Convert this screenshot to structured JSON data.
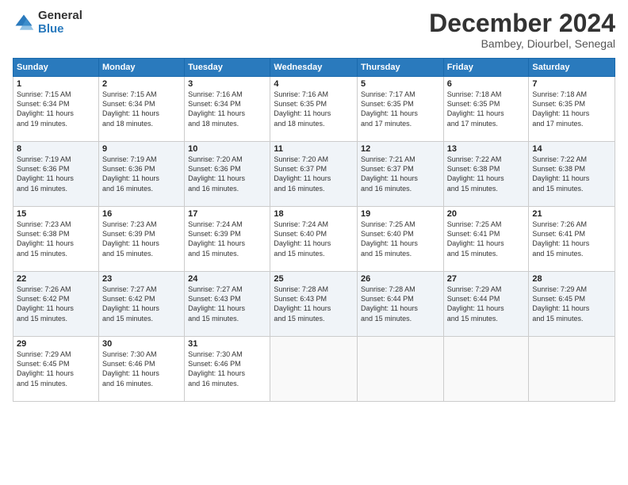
{
  "logo": {
    "general": "General",
    "blue": "Blue"
  },
  "title": "December 2024",
  "location": "Bambey, Diourbel, Senegal",
  "headers": [
    "Sunday",
    "Monday",
    "Tuesday",
    "Wednesday",
    "Thursday",
    "Friday",
    "Saturday"
  ],
  "weeks": [
    [
      {
        "day": "1",
        "info": "Sunrise: 7:15 AM\nSunset: 6:34 PM\nDaylight: 11 hours\nand 19 minutes."
      },
      {
        "day": "2",
        "info": "Sunrise: 7:15 AM\nSunset: 6:34 PM\nDaylight: 11 hours\nand 18 minutes."
      },
      {
        "day": "3",
        "info": "Sunrise: 7:16 AM\nSunset: 6:34 PM\nDaylight: 11 hours\nand 18 minutes."
      },
      {
        "day": "4",
        "info": "Sunrise: 7:16 AM\nSunset: 6:35 PM\nDaylight: 11 hours\nand 18 minutes."
      },
      {
        "day": "5",
        "info": "Sunrise: 7:17 AM\nSunset: 6:35 PM\nDaylight: 11 hours\nand 17 minutes."
      },
      {
        "day": "6",
        "info": "Sunrise: 7:18 AM\nSunset: 6:35 PM\nDaylight: 11 hours\nand 17 minutes."
      },
      {
        "day": "7",
        "info": "Sunrise: 7:18 AM\nSunset: 6:35 PM\nDaylight: 11 hours\nand 17 minutes."
      }
    ],
    [
      {
        "day": "8",
        "info": "Sunrise: 7:19 AM\nSunset: 6:36 PM\nDaylight: 11 hours\nand 16 minutes."
      },
      {
        "day": "9",
        "info": "Sunrise: 7:19 AM\nSunset: 6:36 PM\nDaylight: 11 hours\nand 16 minutes."
      },
      {
        "day": "10",
        "info": "Sunrise: 7:20 AM\nSunset: 6:36 PM\nDaylight: 11 hours\nand 16 minutes."
      },
      {
        "day": "11",
        "info": "Sunrise: 7:20 AM\nSunset: 6:37 PM\nDaylight: 11 hours\nand 16 minutes."
      },
      {
        "day": "12",
        "info": "Sunrise: 7:21 AM\nSunset: 6:37 PM\nDaylight: 11 hours\nand 16 minutes."
      },
      {
        "day": "13",
        "info": "Sunrise: 7:22 AM\nSunset: 6:38 PM\nDaylight: 11 hours\nand 15 minutes."
      },
      {
        "day": "14",
        "info": "Sunrise: 7:22 AM\nSunset: 6:38 PM\nDaylight: 11 hours\nand 15 minutes."
      }
    ],
    [
      {
        "day": "15",
        "info": "Sunrise: 7:23 AM\nSunset: 6:38 PM\nDaylight: 11 hours\nand 15 minutes."
      },
      {
        "day": "16",
        "info": "Sunrise: 7:23 AM\nSunset: 6:39 PM\nDaylight: 11 hours\nand 15 minutes."
      },
      {
        "day": "17",
        "info": "Sunrise: 7:24 AM\nSunset: 6:39 PM\nDaylight: 11 hours\nand 15 minutes."
      },
      {
        "day": "18",
        "info": "Sunrise: 7:24 AM\nSunset: 6:40 PM\nDaylight: 11 hours\nand 15 minutes."
      },
      {
        "day": "19",
        "info": "Sunrise: 7:25 AM\nSunset: 6:40 PM\nDaylight: 11 hours\nand 15 minutes."
      },
      {
        "day": "20",
        "info": "Sunrise: 7:25 AM\nSunset: 6:41 PM\nDaylight: 11 hours\nand 15 minutes."
      },
      {
        "day": "21",
        "info": "Sunrise: 7:26 AM\nSunset: 6:41 PM\nDaylight: 11 hours\nand 15 minutes."
      }
    ],
    [
      {
        "day": "22",
        "info": "Sunrise: 7:26 AM\nSunset: 6:42 PM\nDaylight: 11 hours\nand 15 minutes."
      },
      {
        "day": "23",
        "info": "Sunrise: 7:27 AM\nSunset: 6:42 PM\nDaylight: 11 hours\nand 15 minutes."
      },
      {
        "day": "24",
        "info": "Sunrise: 7:27 AM\nSunset: 6:43 PM\nDaylight: 11 hours\nand 15 minutes."
      },
      {
        "day": "25",
        "info": "Sunrise: 7:28 AM\nSunset: 6:43 PM\nDaylight: 11 hours\nand 15 minutes."
      },
      {
        "day": "26",
        "info": "Sunrise: 7:28 AM\nSunset: 6:44 PM\nDaylight: 11 hours\nand 15 minutes."
      },
      {
        "day": "27",
        "info": "Sunrise: 7:29 AM\nSunset: 6:44 PM\nDaylight: 11 hours\nand 15 minutes."
      },
      {
        "day": "28",
        "info": "Sunrise: 7:29 AM\nSunset: 6:45 PM\nDaylight: 11 hours\nand 15 minutes."
      }
    ],
    [
      {
        "day": "29",
        "info": "Sunrise: 7:29 AM\nSunset: 6:45 PM\nDaylight: 11 hours\nand 15 minutes."
      },
      {
        "day": "30",
        "info": "Sunrise: 7:30 AM\nSunset: 6:46 PM\nDaylight: 11 hours\nand 16 minutes."
      },
      {
        "day": "31",
        "info": "Sunrise: 7:30 AM\nSunset: 6:46 PM\nDaylight: 11 hours\nand 16 minutes."
      },
      {
        "day": "",
        "info": ""
      },
      {
        "day": "",
        "info": ""
      },
      {
        "day": "",
        "info": ""
      },
      {
        "day": "",
        "info": ""
      }
    ]
  ]
}
